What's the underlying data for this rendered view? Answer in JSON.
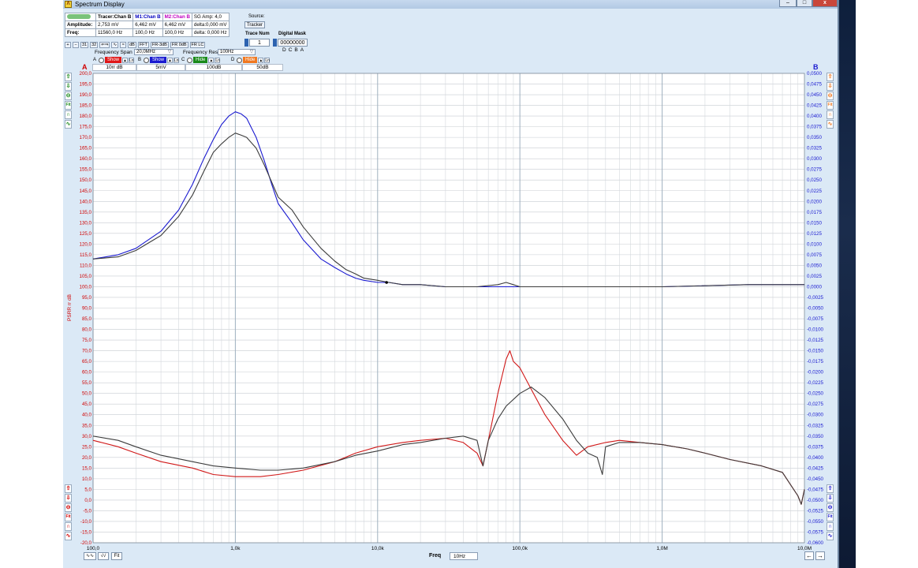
{
  "window": {
    "title": "Spectrum Display",
    "app_icon": "Λ"
  },
  "info": {
    "logo": "",
    "tracer": "Tracer:Chan B",
    "m1": "M1:Chan B",
    "m2": "M2:Chan B",
    "sg": "SG Amp: 4,0",
    "amplitude_label": "Amplitude:",
    "amp_tracer": "2,753 mV",
    "amp_m1": "6,462 mV",
    "amp_m2": "6,462 mV",
    "amp_delta": "delta:0,000 mV",
    "freq_label": "Freq:",
    "freq_tracer": "11560,0 Hz",
    "freq_m1": "100,0 Hz",
    "freq_m2": "100,0 Hz",
    "freq_delta": "delta: 0,000 Hz"
  },
  "source": {
    "label": "Source:",
    "value": "Tracker"
  },
  "trace_num": {
    "label": "Trace Num",
    "value": "1"
  },
  "digital_mask": {
    "label": "Digital Mask",
    "value": "00000000",
    "bits": "DCBA"
  },
  "toolbar": [
    "+",
    "−",
    "31",
    "32",
    "⇐⇒",
    "∿",
    "≈",
    "dB",
    "FFT",
    "FR-3dB",
    "FR 0dB",
    "FR LC"
  ],
  "frequency_span": {
    "label": "Frequency Span",
    "value": "20,0MHz"
  },
  "frequency_res": {
    "label": "Frequency Res",
    "value": "100Hz"
  },
  "traces": [
    {
      "letter": "A",
      "state": "Show",
      "color": "#e01818"
    },
    {
      "letter": "B",
      "state": "Show",
      "color": "#1a1ad0"
    },
    {
      "letter": "C",
      "state": "Hide",
      "color": "#1a8a1a"
    },
    {
      "letter": "D",
      "state": "Hide",
      "color": "#f07820"
    }
  ],
  "scales": [
    "10rr dB",
    "5mV",
    "100dB",
    "50dB"
  ],
  "axis_a_label": "A",
  "axis_b_label": "B",
  "bottom": {
    "freq_label": "Freq",
    "freq_value": "10Hz",
    "fit_label": "Fit"
  },
  "chart_data": {
    "type": "line",
    "x_scale": "log",
    "xlim": [
      100,
      10000000
    ],
    "x_ticks": [
      "100,0",
      "1,0k",
      "10,0k",
      "100,0k",
      "1,0M",
      "10,0M"
    ],
    "left_axis": {
      "label": "PSRR rr dB",
      "ylim": [
        -20,
        200
      ],
      "step": 5,
      "color": "#d00000"
    },
    "right_axis": {
      "label": "",
      "ylim": [
        -0.06,
        0.05
      ],
      "step": 0.0025,
      "color": "#1a1ad0"
    },
    "grid": true,
    "series": [
      {
        "axis": "left",
        "color": "#1a1ad0",
        "x": [
          100,
          150,
          200,
          300,
          400,
          500,
          600,
          700,
          800,
          900,
          1000,
          1100,
          1200,
          1400,
          1600,
          1800,
          2000,
          2500,
          3000,
          4000,
          5000,
          6000,
          7000,
          8000,
          10000,
          12000,
          15000,
          20000,
          30000,
          50000,
          80000,
          100000,
          200000,
          400000,
          1000000,
          4000000,
          10000000
        ],
        "y": [
          113,
          115,
          118,
          126,
          136,
          148,
          160,
          169,
          176,
          180,
          182,
          181,
          179,
          170,
          159,
          148,
          139,
          130,
          122,
          113,
          109,
          106,
          104,
          103,
          102,
          102,
          101,
          101,
          100,
          100,
          100,
          100,
          100,
          100,
          100,
          101,
          101
        ]
      },
      {
        "axis": "left",
        "color": "#3c3c3c",
        "x": [
          100,
          150,
          200,
          300,
          400,
          500,
          600,
          700,
          800,
          900,
          1000,
          1100,
          1200,
          1400,
          1600,
          1800,
          2000,
          2500,
          3000,
          4000,
          5000,
          6000,
          7000,
          8000,
          10000,
          12000,
          15000,
          20000,
          30000,
          50000,
          70000,
          80000,
          90000,
          100000,
          200000,
          400000,
          1000000,
          4000000,
          10000000
        ],
        "y": [
          113,
          114,
          117,
          124,
          133,
          143,
          154,
          163,
          167,
          170,
          172,
          171,
          170,
          165,
          157,
          149,
          142,
          136,
          128,
          118,
          112,
          108,
          106,
          104,
          103,
          102,
          101,
          101,
          100,
          100,
          101,
          102,
          101,
          100,
          100,
          100,
          100,
          101,
          101
        ]
      },
      {
        "axis": "left",
        "color": "#d01818",
        "x": [
          100,
          150,
          200,
          300,
          500,
          700,
          1000,
          1500,
          2000,
          3000,
          5000,
          7000,
          10000,
          15000,
          20000,
          30000,
          40000,
          50000,
          55000,
          60000,
          70000,
          80000,
          85000,
          90000,
          100000,
          120000,
          150000,
          200000,
          250000,
          300000,
          400000,
          500000,
          700000,
          1000000,
          1500000,
          2000000,
          3000000,
          5000000,
          7000000,
          9000000,
          9500000,
          10000000
        ],
        "y": [
          28,
          25,
          22,
          18,
          15,
          12,
          11,
          11,
          12,
          14,
          18,
          22,
          25,
          27,
          28,
          29,
          27,
          22,
          16,
          28,
          50,
          66,
          70,
          65,
          62,
          52,
          40,
          28,
          21,
          25,
          27,
          28,
          27,
          26,
          24,
          22,
          19,
          16,
          13,
          2,
          -2,
          5
        ]
      },
      {
        "axis": "left",
        "color": "#3c3c3c",
        "x": [
          100,
          150,
          200,
          300,
          500,
          700,
          1000,
          1500,
          2000,
          3000,
          5000,
          7000,
          10000,
          15000,
          20000,
          30000,
          40000,
          50000,
          55000,
          60000,
          70000,
          80000,
          100000,
          120000,
          150000,
          200000,
          250000,
          300000,
          350000,
          380000,
          400000,
          500000,
          700000,
          1000000,
          1500000,
          2000000,
          3000000,
          5000000,
          7000000,
          9000000,
          9500000,
          10000000
        ],
        "y": [
          30,
          28,
          25,
          21,
          18,
          16,
          15,
          14,
          14,
          15,
          18,
          21,
          23,
          26,
          27,
          29,
          30,
          28,
          16,
          28,
          38,
          44,
          50,
          53,
          48,
          38,
          28,
          22,
          20,
          12,
          25,
          27,
          27,
          26,
          24,
          22,
          19,
          16,
          13,
          2,
          -2,
          5
        ]
      }
    ],
    "markers": [
      {
        "x": 11560,
        "y": 102
      }
    ]
  }
}
